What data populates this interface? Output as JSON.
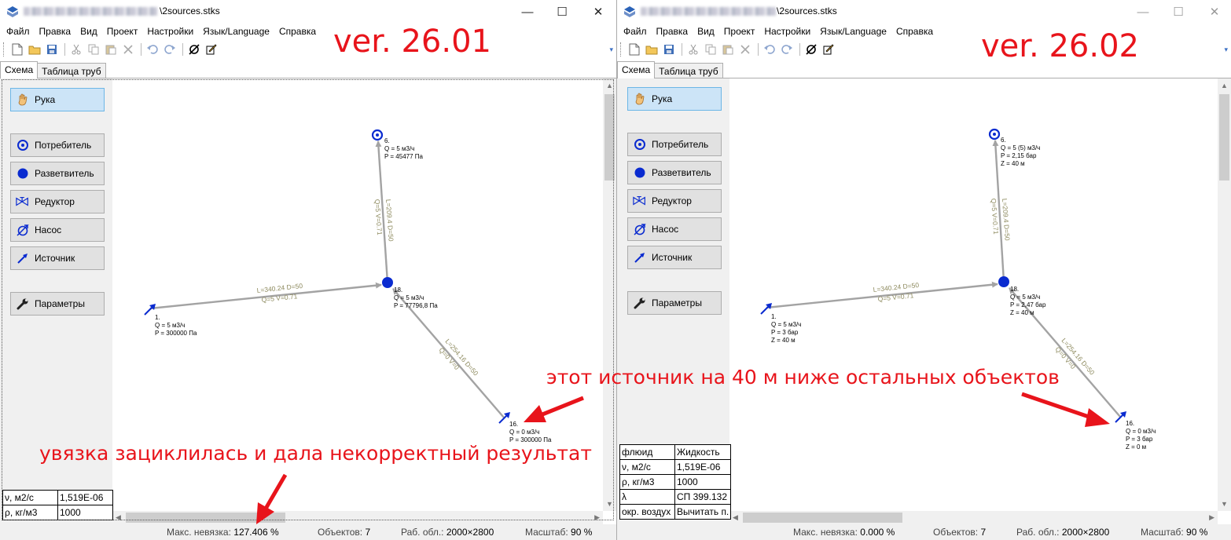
{
  "window_left": {
    "title_suffix": "\\2sources.stks",
    "menu": [
      "Файл",
      "Правка",
      "Вид",
      "Проект",
      "Настройки",
      "Язык/Language",
      "Справка"
    ],
    "tabs": [
      "Схема",
      "Таблица труб"
    ],
    "panel_buttons": {
      "hand": "Рука",
      "consumer": "Потребитель",
      "splitter": "Разветвитель",
      "reducer": "Редуктор",
      "pump": "Насос",
      "source": "Источник",
      "params": "Параметры"
    },
    "nodes": {
      "n6": [
        "6.",
        "Q = 5 м3/ч",
        "P = 45477 Па"
      ],
      "n18": [
        "18.",
        "Q = 5 м3/ч",
        "P = 77796,8 Па"
      ],
      "n1": [
        "1.",
        "Q = 5 м3/ч",
        "P = 300000 Па"
      ],
      "n16": [
        "16.",
        "Q = 0 м3/ч",
        "P = 300000 Па"
      ]
    },
    "pipes": {
      "p_up": [
        "L=209.4  D=50",
        "Q=5  V=0.71"
      ],
      "p_left": [
        "L=340.24  D=50",
        "Q=5  V=0.71"
      ],
      "p_diag": [
        "L=254.16  D=50",
        "Q=0  V=0"
      ]
    },
    "props": [
      [
        "ν, м2/с",
        "1,519E-06"
      ],
      [
        "ρ, кг/м3",
        "1000"
      ]
    ],
    "status": {
      "residual_label": "Макс. невязка:",
      "residual_value": "127.406 %",
      "objects_label": "Объектов:",
      "objects_value": "7",
      "area_label": "Раб. обл.:",
      "area_value": "2000×2800",
      "scale_label": "Масштаб:",
      "scale_value": "90 %"
    }
  },
  "window_right": {
    "title_suffix": "\\2sources.stks",
    "menu": [
      "Файл",
      "Правка",
      "Вид",
      "Проект",
      "Настройки",
      "Язык/Language",
      "Справка"
    ],
    "tabs": [
      "Схема",
      "Таблица труб"
    ],
    "panel_buttons": {
      "hand": "Рука",
      "consumer": "Потребитель",
      "splitter": "Разветвитель",
      "reducer": "Редуктор",
      "pump": "Насос",
      "source": "Источник",
      "params": "Параметры"
    },
    "nodes": {
      "n6": [
        "6.",
        "Q = 5 (5) м3/ч",
        "P = 2,15 бар",
        "Z = 40 м"
      ],
      "n18": [
        "18.",
        "Q = 5 м3/ч",
        "P = 2,47 бар",
        "Z = 40 м"
      ],
      "n1": [
        "1.",
        "Q = 5 м3/ч",
        "P = 3 бар",
        "Z = 40 м"
      ],
      "n16": [
        "16.",
        "Q = 0 м3/ч",
        "P = 3 бар",
        "Z = 0 м"
      ]
    },
    "pipes": {
      "p_up": [
        "L=209.4  D=50",
        "Q=5  V=0.71"
      ],
      "p_left": [
        "L=340.24  D=50",
        "Q=5  V=0.71"
      ],
      "p_diag": [
        "L=254.16  D=50",
        "Q=0  V=0"
      ]
    },
    "props": [
      [
        "флюид",
        "Жидкость"
      ],
      [
        "ν, м2/с",
        "1,519E-06"
      ],
      [
        "ρ, кг/м3",
        "1000"
      ],
      [
        "λ",
        "СП 399.132"
      ],
      [
        "окр. воздух",
        "Вычитать п."
      ]
    ],
    "status": {
      "residual_label": "Макс. невязка:",
      "residual_value": "0.000 %",
      "objects_label": "Объектов:",
      "objects_value": "7",
      "area_label": "Раб. обл.:",
      "area_value": "2000×2800",
      "scale_label": "Масштаб:",
      "scale_value": "90 %"
    }
  },
  "annotations": {
    "ver_left": "ver. 26.01",
    "ver_right": "ver. 26.02",
    "source_note": "этот источник на 40 м ниже остальных объектов",
    "loop_note": "увязка зациклилась и дала некорректный результат"
  },
  "colors": {
    "annotation": "#e8141b",
    "node": "#0a2bd0",
    "pipe": "#a3a3a3",
    "pipe_label": "#8d8a5e"
  }
}
